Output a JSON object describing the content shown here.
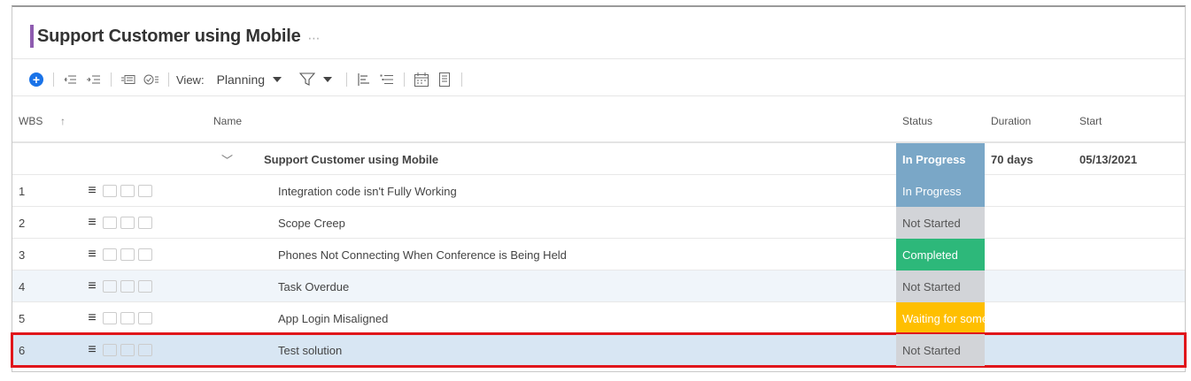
{
  "project": {
    "title": "Support Customer using Mobile",
    "more": "⋯"
  },
  "toolbar": {
    "view_label": "View:",
    "view_value": "Planning"
  },
  "columns": {
    "wbs": "WBS",
    "name": "Name",
    "status": "Status",
    "duration": "Duration",
    "start": "Start"
  },
  "summary_row": {
    "name": "Support Customer using Mobile",
    "status": "In Progress",
    "duration": "70 days",
    "start": "05/13/2021",
    "status_color": "#7aa7c7"
  },
  "tasks": [
    {
      "wbs": "1",
      "name": "Integration code isn't Fully Working",
      "status": "In Progress",
      "status_color": "#7aa7c7"
    },
    {
      "wbs": "2",
      "name": "Scope Creep",
      "status": "Not Started",
      "status_color": "#d2d4d8"
    },
    {
      "wbs": "3",
      "name": "Phones Not Connecting When Conference is Being Held",
      "status": "Completed",
      "status_color": "#2db87a"
    },
    {
      "wbs": "4",
      "name": "Task Overdue",
      "status": "Not Started",
      "status_color": "#d2d4d8"
    },
    {
      "wbs": "5",
      "name": "App Login Misaligned",
      "status": "Waiting for some",
      "status_color": "#ffbf00"
    },
    {
      "wbs": "6",
      "name": "Test solution",
      "status": "Not Started",
      "status_color": "#d2d4d8"
    }
  ]
}
